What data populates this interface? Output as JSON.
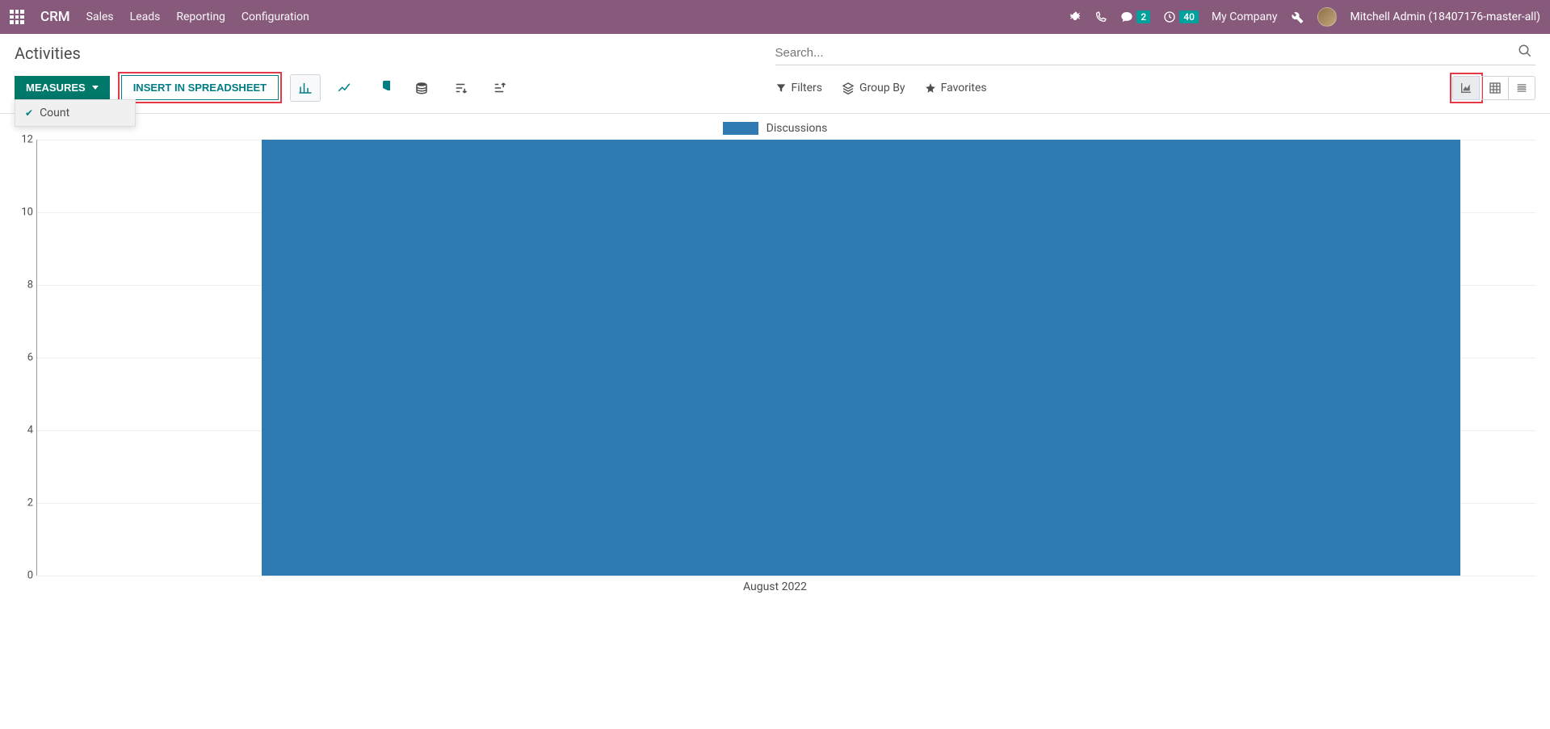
{
  "navbar": {
    "brand": "CRM",
    "menu": [
      "Sales",
      "Leads",
      "Reporting",
      "Configuration"
    ],
    "messages_badge": "2",
    "activities_badge": "40",
    "company": "My Company",
    "user": "Mitchell Admin (18407176-master-all)"
  },
  "page": {
    "title": "Activities",
    "search_placeholder": "Search..."
  },
  "toolbar": {
    "measures_label": "MEASURES",
    "insert_label": "INSERT IN SPREADSHEET",
    "measures_menu": {
      "count": "Count"
    },
    "filters": "Filters",
    "group_by": "Group By",
    "favorites": "Favorites"
  },
  "chart_data": {
    "type": "bar",
    "categories": [
      "August 2022"
    ],
    "series": [
      {
        "name": "Discussions",
        "values": [
          12
        ]
      }
    ],
    "title": "",
    "xlabel": "",
    "ylabel": "",
    "ylim": [
      0,
      12
    ],
    "y_ticks": [
      0,
      2,
      4,
      6,
      8,
      10,
      12
    ],
    "legend": [
      "Discussions"
    ]
  }
}
